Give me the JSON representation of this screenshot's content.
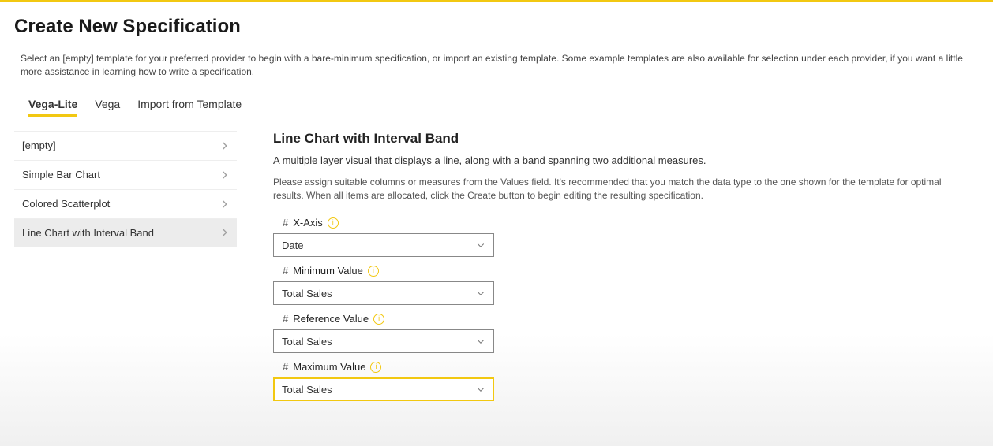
{
  "header": {
    "title": "Create New Specification",
    "intro": "Select an [empty] template for your preferred provider to begin with a bare-minimum specification, or import an existing template. Some example templates are also available for selection under each provider, if you want a little more assistance in learning how to write a specification."
  },
  "tabs": {
    "items": [
      {
        "label": "Vega-Lite",
        "active": true
      },
      {
        "label": "Vega",
        "active": false
      },
      {
        "label": "Import from Template",
        "active": false
      }
    ]
  },
  "sidebar": {
    "items": [
      {
        "label": "[empty]",
        "selected": false
      },
      {
        "label": "Simple Bar Chart",
        "selected": false
      },
      {
        "label": "Colored Scatterplot",
        "selected": false
      },
      {
        "label": "Line Chart with Interval Band",
        "selected": true
      }
    ]
  },
  "detail": {
    "title": "Line Chart with Interval Band",
    "subtitle": "A multiple layer visual that displays a line, along with a band spanning two additional measures.",
    "help": "Please assign suitable columns or measures from the Values field. It's recommended that you match the data type to the one shown for the template for optimal results. When all items are allocated, click the Create button to begin editing the resulting specification.",
    "fields": [
      {
        "label": "X-Axis",
        "value": "Date",
        "focused": false
      },
      {
        "label": "Minimum Value",
        "value": "Total Sales",
        "focused": false
      },
      {
        "label": "Reference Value",
        "value": "Total Sales",
        "focused": false
      },
      {
        "label": "Maximum Value",
        "value": "Total Sales",
        "focused": true
      }
    ]
  }
}
